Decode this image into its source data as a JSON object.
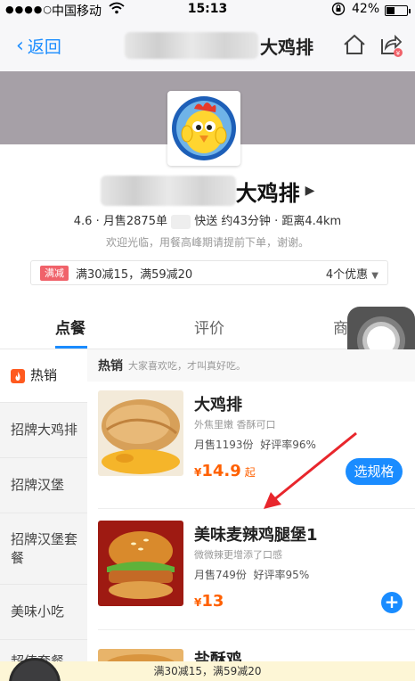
{
  "status_bar": {
    "signal": "●●●●○",
    "carrier": "中国移动",
    "wifi_icon": "wifi-icon",
    "time": "15:13",
    "lock_icon": "rotation-lock-icon",
    "battery_percent": "42%",
    "battery_level": 0.42
  },
  "nav": {
    "back_label": "返回",
    "title_visible": "大鸡排",
    "home_icon": "home-icon",
    "share_icon": "share-icon"
  },
  "shop": {
    "name_visible": "大鸡排",
    "rating": "4.6",
    "monthly_sales": "月售2875单",
    "delivery_time": "快送 约43分钟",
    "distance": "距离4.4km",
    "notice": "欢迎光临，用餐高峰期请提前下单，谢谢。",
    "promo_tag": "满减",
    "promo_text": "满30减15，满59减20",
    "promo_count": "4个优惠"
  },
  "tabs": {
    "order": "点餐",
    "reviews": "评价",
    "merchant": "商"
  },
  "sidebar": {
    "items": [
      {
        "label": "热销",
        "icon": "fire-icon"
      },
      {
        "label": "招牌大鸡排"
      },
      {
        "label": "招牌汉堡"
      },
      {
        "label": "招牌汉堡套餐"
      },
      {
        "label": "美味小吃"
      },
      {
        "label": "超值套餐"
      }
    ]
  },
  "section": {
    "title": "热销",
    "subtitle": "大家喜欢吃，才叫真好吃。"
  },
  "items": [
    {
      "name": "大鸡排",
      "desc": "外焦里嫩 香酥可口",
      "sales": "月售1193份",
      "rating": "好评率96%",
      "currency": "¥",
      "price": "14.9",
      "price_unit": "起",
      "action_label": "选规格"
    },
    {
      "name": "美味麦辣鸡腿堡1",
      "desc": "微微辣更增添了口感",
      "sales": "月售749份",
      "rating": "好评率95%",
      "currency": "¥",
      "price": "13",
      "action_label": "+"
    },
    {
      "name": "盐酥鸡"
    }
  ],
  "bottom_bar": {
    "promo_text": "满30减15，满59减20"
  },
  "colors": {
    "accent": "#1a8cff",
    "price": "#ff6000",
    "promo_tag": "#f0626a",
    "arrow": "#e8262c"
  }
}
